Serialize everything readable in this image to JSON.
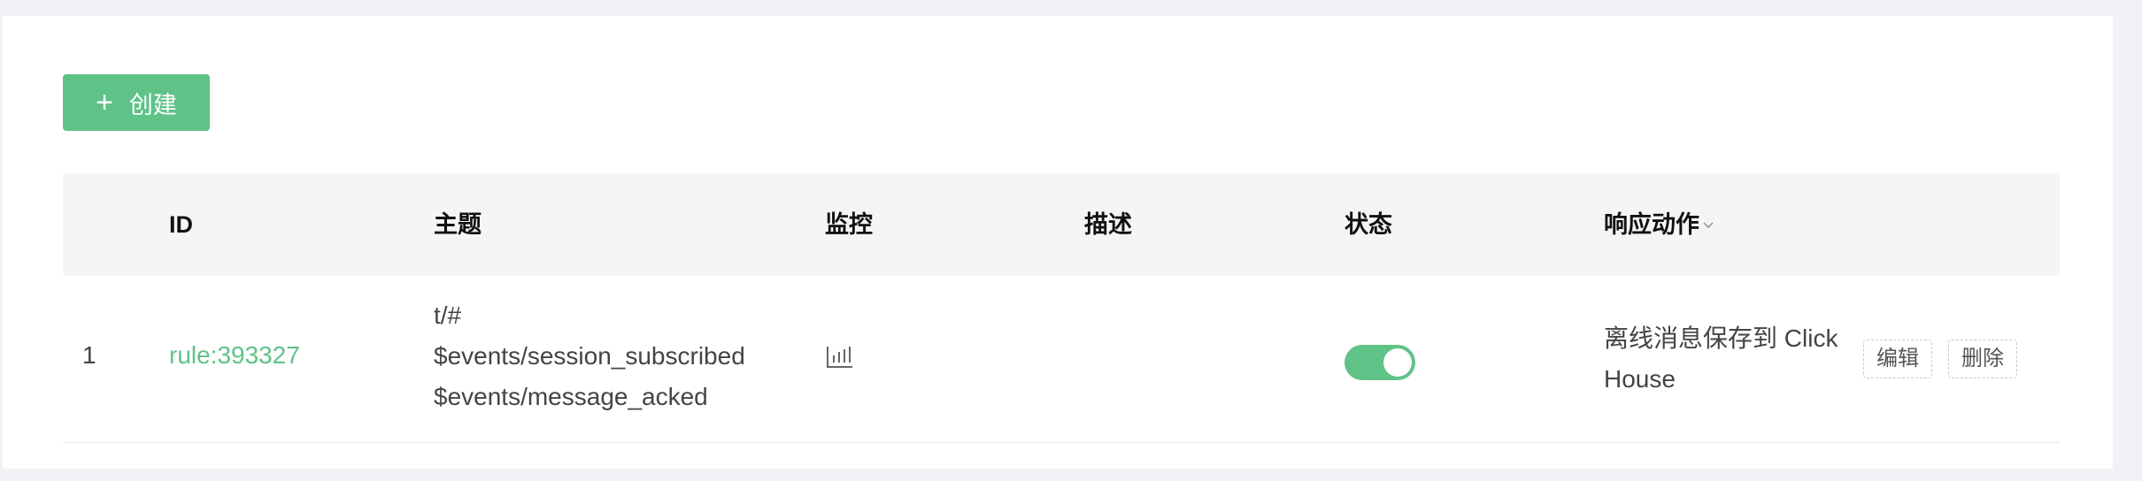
{
  "toolbar": {
    "create_label": "创建"
  },
  "table": {
    "columns": [
      "ID",
      "主题",
      "监控",
      "描述",
      "状态",
      "响应动作"
    ],
    "rows": [
      {
        "index": "1",
        "id": "rule:393327",
        "topics": [
          "t/#",
          "$events/session_subscribed",
          "$events/message_acked"
        ],
        "description": "",
        "enabled": true,
        "action": "离线消息保存到 ClickHouse",
        "edit_label": "编辑",
        "delete_label": "删除"
      }
    ]
  },
  "colors": {
    "accent": "#5fc287",
    "header_bg": "#f5f5f5",
    "page_bg": "#f0f2f5"
  },
  "icons": {
    "monitor": "bar-chart-icon",
    "sort": "chevron-down-icon",
    "create": "plus-icon"
  }
}
